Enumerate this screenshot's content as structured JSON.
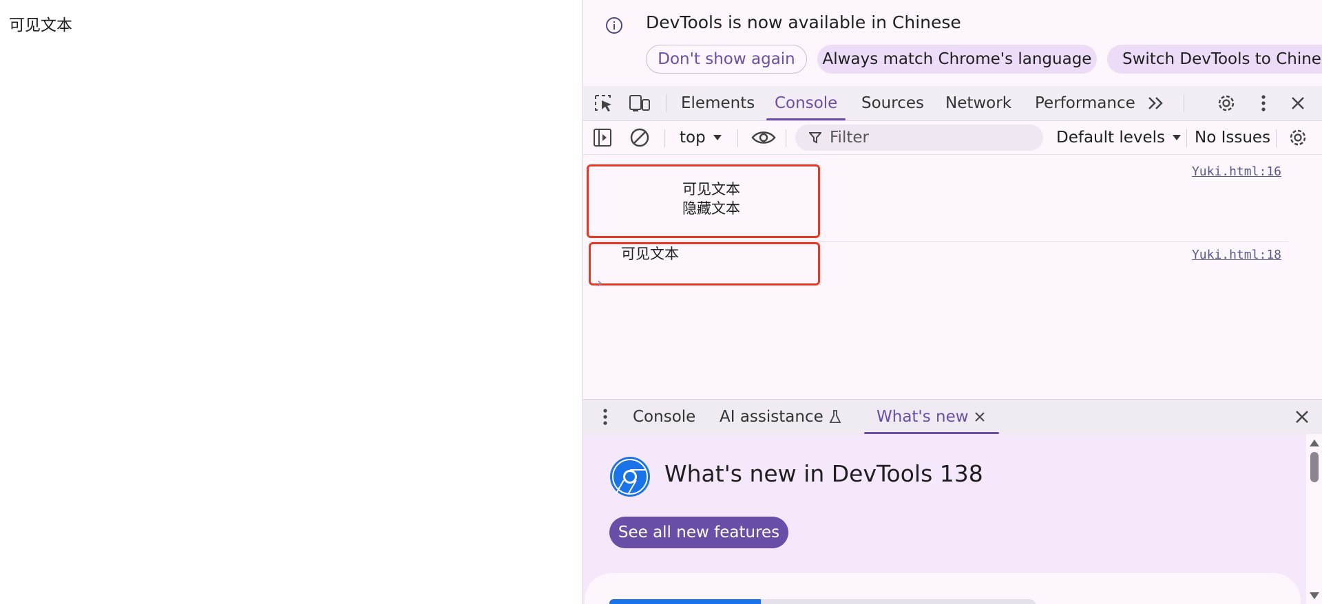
{
  "page": {
    "visible_text": "可见文本"
  },
  "banner": {
    "title": "DevTools is now available in Chinese",
    "buttons": {
      "dont_show": "Don't show again",
      "always_match": "Always match Chrome's language",
      "switch": "Switch DevTools to Chinese"
    }
  },
  "main_toolbar": {
    "tabs": [
      "Elements",
      "Console",
      "Sources",
      "Network",
      "Performance"
    ],
    "active_tab": "Console"
  },
  "console_toolbar": {
    "context": "top",
    "filter_placeholder": "Filter",
    "levels": "Default levels",
    "issues": "No Issues"
  },
  "console": {
    "messages": [
      {
        "lines": [
          "可见文本",
          "隐藏文本"
        ],
        "source": "Yuki.html:16"
      },
      {
        "lines": [
          "可见文本"
        ],
        "source": "Yuki.html:18"
      }
    ]
  },
  "drawer": {
    "tabs": [
      "Console",
      "AI assistance",
      "What's new"
    ],
    "active_tab": "What's new"
  },
  "whats_new": {
    "title": "What's new in DevTools 138",
    "button": "See all new features"
  },
  "colors": {
    "accent": "#6a4fa8",
    "highlight_box": "#e53b26",
    "panel_bg": "#fdf7fd",
    "whats_new_bg": "#f5e8fb"
  }
}
